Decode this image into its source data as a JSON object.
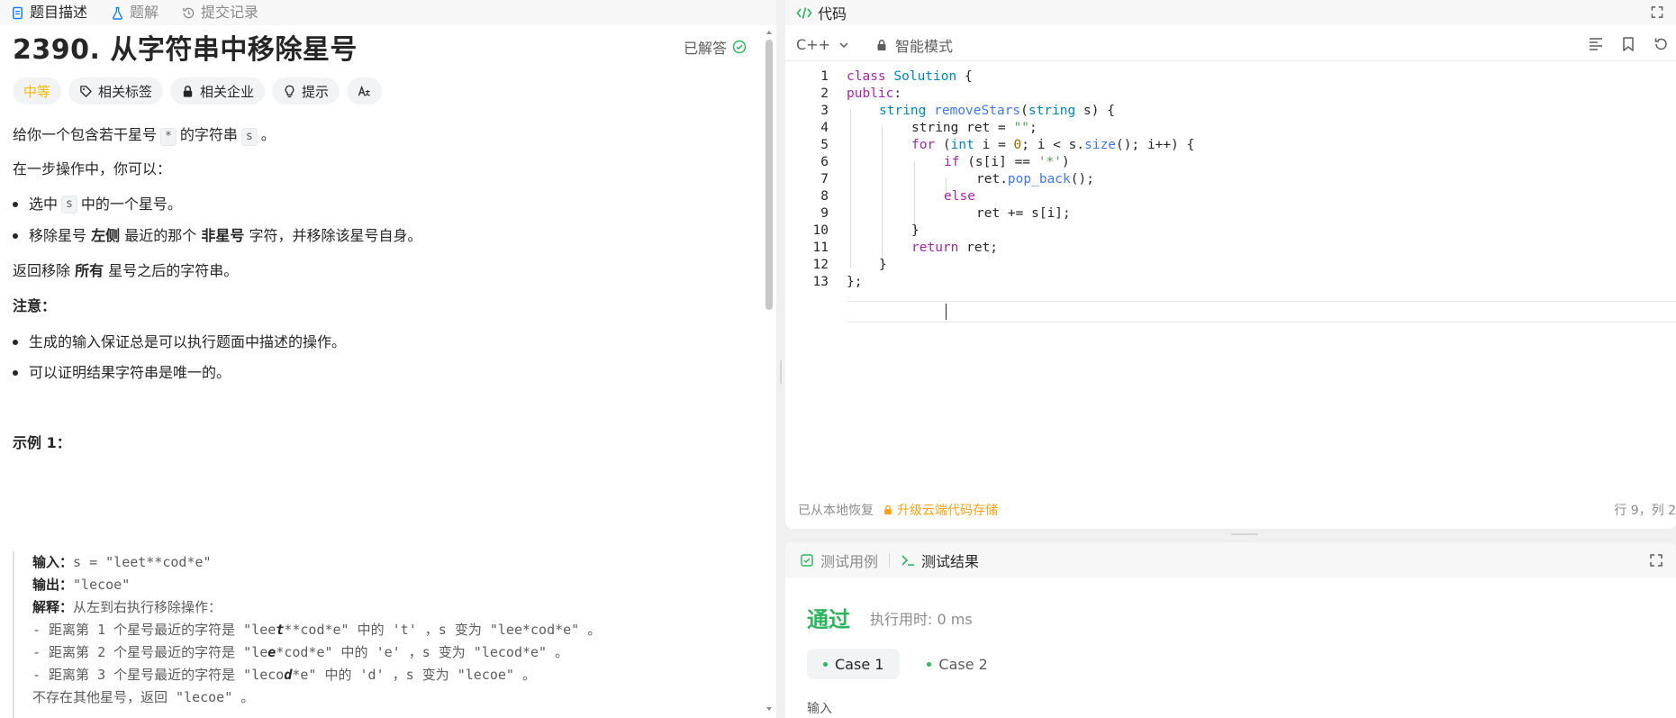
{
  "left_tabs": [
    {
      "label": "题目描述"
    },
    {
      "label": "题解"
    },
    {
      "label": "提交记录"
    }
  ],
  "problem": {
    "title": "2390. 从字符串中移除星号",
    "solved": "已解答"
  },
  "tags": {
    "difficulty": "中等",
    "related_tags": "相关标签",
    "companies": "相关企业",
    "hint": "提示",
    "translate_glyph": "A̵"
  },
  "description": {
    "p1_a": "给你一个包含若干星号",
    "p1_code1": "*",
    "p1_b": "的字符串",
    "p1_code2": "s",
    "p1_c": "。",
    "p2": "在一步操作中，你可以：",
    "b1_a": "选中",
    "b1_code": "s",
    "b1_b": "中的一个星号。",
    "b2_a": "移除星号",
    "b2_bold1": "左侧",
    "b2_b": "最近的那个",
    "b2_bold2": "非星号",
    "b2_c": "字符，并移除该星号自身。",
    "p3_a": "返回移除",
    "p3_bold": "所有",
    "p3_b": "星号之后的字符串。",
    "note_title": "注意：",
    "n1": "生成的输入保证总是可以执行题面中描述的操作。",
    "n2": "可以证明结果字符串是唯一的。",
    "example_title": "示例 1："
  },
  "example": {
    "input_label": "输入：",
    "input_value": "s = \"leet**cod*e\"",
    "output_label": "输出：",
    "output_value": "\"lecoe\"",
    "explain_label": "解释：",
    "explain_value": "从左到右执行移除操作：",
    "lines": [
      {
        "a": "- 距离第 1 个星号最近的字符是 \"lee",
        "em": "t",
        "b": "**cod*e\" 中的 't' ，s 变为 \"lee*cod*e\" 。"
      },
      {
        "a": "- 距离第 2 个星号最近的字符是 \"le",
        "em": "e",
        "b": "*cod*e\" 中的 'e' ，s 变为 \"lecod*e\" 。"
      },
      {
        "a": "- 距离第 3 个星号最近的字符是 \"leco",
        "em": "d",
        "b": "*e\" 中的 'd' ，s 变为 \"lecoe\" 。"
      }
    ],
    "last": "不存在其他星号，返回 \"lecoe\" 。"
  },
  "code_panel": {
    "title": "代码",
    "language": "C++",
    "mode": "智能模式",
    "restored": "已从本地恢复",
    "upgrade": "升级云端代码存储",
    "position": "行 9，列 2"
  },
  "code_lines": [
    {
      "n": "1"
    },
    {
      "n": "2"
    },
    {
      "n": "3"
    },
    {
      "n": "4"
    },
    {
      "n": "5"
    },
    {
      "n": "6"
    },
    {
      "n": "7"
    },
    {
      "n": "8"
    },
    {
      "n": "9"
    },
    {
      "n": "10"
    },
    {
      "n": "11"
    },
    {
      "n": "12"
    },
    {
      "n": "13"
    }
  ],
  "code": {
    "l1_kw": "class",
    "l1_ty": "Solution",
    "l1_rest": " {",
    "l2_kw": "public",
    "l2_rest": ":",
    "l3_ty": "string",
    "l3_fn": "removeStars",
    "l3_a": "(",
    "l3_ty2": "string",
    "l3_b": " s) {",
    "l4_a": "string ret = ",
    "l4_st": "\"\"",
    "l4_b": ";",
    "l5_kw": "for",
    "l5_a": " (",
    "l5_ty": "int",
    "l5_b": " i = ",
    "l5_nu": "0",
    "l5_c": "; i < s.",
    "l5_fn": "size",
    "l5_d": "(); i++) {",
    "l6_kw": "if",
    "l6_a": " (s[i] == ",
    "l6_st": "'*'",
    "l6_b": ")",
    "l7_a": "ret.",
    "l7_fn": "pop_back",
    "l7_b": "();",
    "l8_kw": "else",
    "l9": "ret += s[i];",
    "l10": "}",
    "l11_kw": "return",
    "l11_rest": " ret;",
    "l12": "}",
    "l13": "};"
  },
  "result_panel": {
    "tab_testcase": "测试用例",
    "tab_result": "测试结果",
    "status": "通过",
    "runtime": "执行用时: 0 ms",
    "case1": "Case 1",
    "case2": "Case 2",
    "input_label": "输入"
  },
  "colors": {
    "accent_green": "#2db55d",
    "difficulty_yellow": "#ffb800",
    "upgrade_orange": "#ffa116"
  }
}
